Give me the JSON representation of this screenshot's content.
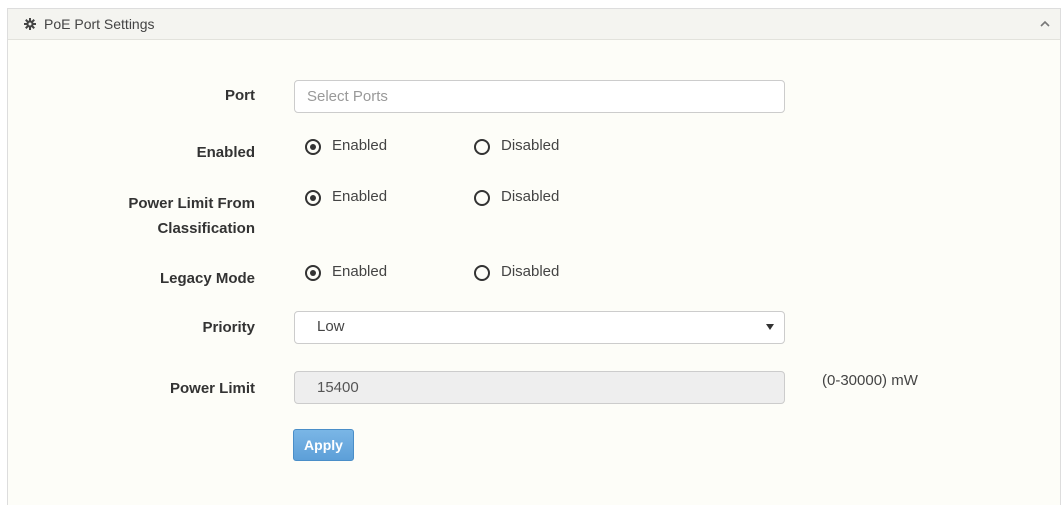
{
  "panel": {
    "title": "PoE Port Settings",
    "header_icon": "gear-icon",
    "collapse_icon": "chevron-up-icon"
  },
  "form": {
    "port": {
      "label": "Port",
      "placeholder": "Select Ports",
      "value": ""
    },
    "enabled": {
      "label": "Enabled",
      "options": [
        "Enabled",
        "Disabled"
      ],
      "selected": "Enabled"
    },
    "power_limit_from_classification": {
      "label_line1": "Power Limit From",
      "label_line2": "Classification",
      "options": [
        "Enabled",
        "Disabled"
      ],
      "selected": "Enabled"
    },
    "legacy_mode": {
      "label": "Legacy Mode",
      "options": [
        "Enabled",
        "Disabled"
      ],
      "selected": "Enabled"
    },
    "priority": {
      "label": "Priority",
      "value": "Low"
    },
    "power_limit": {
      "label": "Power Limit",
      "value": "15400",
      "unit": "(0-30000) mW"
    },
    "apply_label": "Apply"
  },
  "colors": {
    "panel_bg": "#fdfdf8",
    "header_bg": "#f4f4f0",
    "button_blue": "#5d9fd8",
    "readonly_bg": "#eeeeee"
  }
}
